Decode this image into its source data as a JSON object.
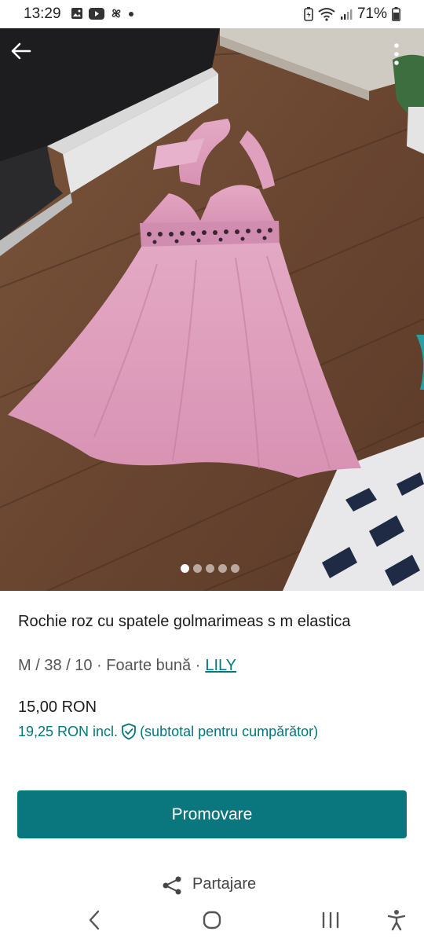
{
  "status": {
    "time": "13:29",
    "battery": "71%",
    "icons": [
      "gallery-icon",
      "youtube-icon",
      "pinwheel-icon",
      "dot-icon",
      "battery-saver-icon",
      "wifi-icon",
      "signal-icon",
      "battery-icon"
    ]
  },
  "photo": {
    "image_count": 5,
    "active_index": 0
  },
  "listing": {
    "title": "Rochie roz cu spatele golmarimeas s m elastica",
    "meta": "M / 38 / 10 · Foarte bună ·",
    "brand": "LILY",
    "price": "15,00 RON",
    "price_incl": "19,25 RON incl.",
    "price_incl_note": "(subtotal pentru cumpărător)"
  },
  "actions": {
    "promote_label": "Promovare",
    "share_label": "Partajare"
  },
  "colors": {
    "accent": "#09777d",
    "link": "#00787e"
  }
}
